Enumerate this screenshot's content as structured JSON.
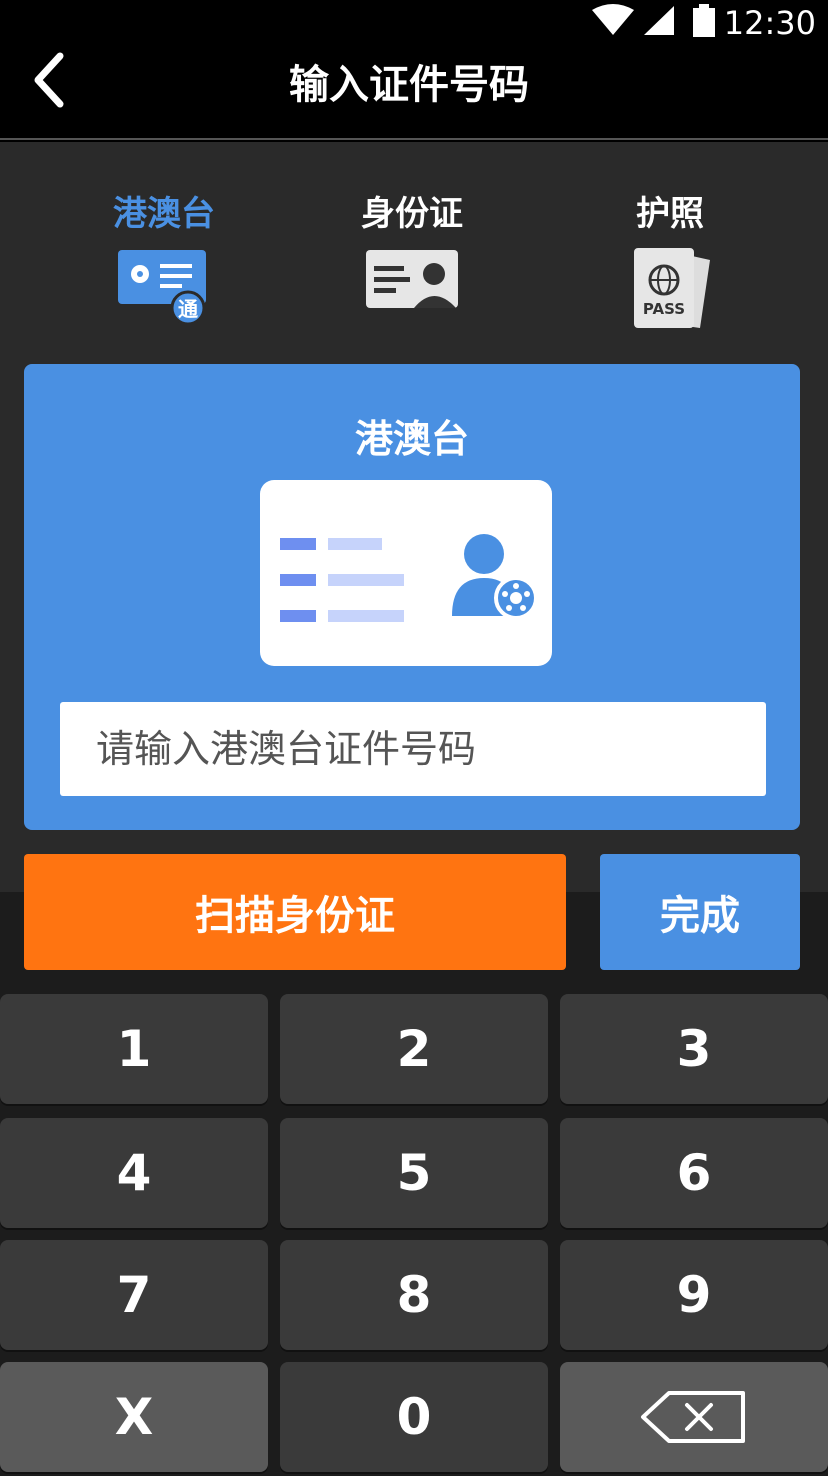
{
  "status_bar": {
    "time": "12:30"
  },
  "nav": {
    "title": "输入证件号码"
  },
  "tabs": [
    {
      "label": "港澳台",
      "icon_badge": "通"
    },
    {
      "label": "身份证"
    },
    {
      "label": "护照",
      "icon_text": "PASS"
    }
  ],
  "card": {
    "title": "港澳台",
    "input_placeholder": "请输入港澳台证件号码"
  },
  "actions": {
    "scan_label": "扫描身份证",
    "done_label": "完成"
  },
  "keypad": {
    "k1": "1",
    "k2": "2",
    "k3": "3",
    "k4": "4",
    "k5": "5",
    "k6": "6",
    "k7": "7",
    "k8": "8",
    "k9": "9",
    "kx": "X",
    "k0": "0"
  },
  "colors": {
    "accent": "#4a90e2",
    "scan": "#ff7411",
    "background": "#2a2a2a"
  }
}
